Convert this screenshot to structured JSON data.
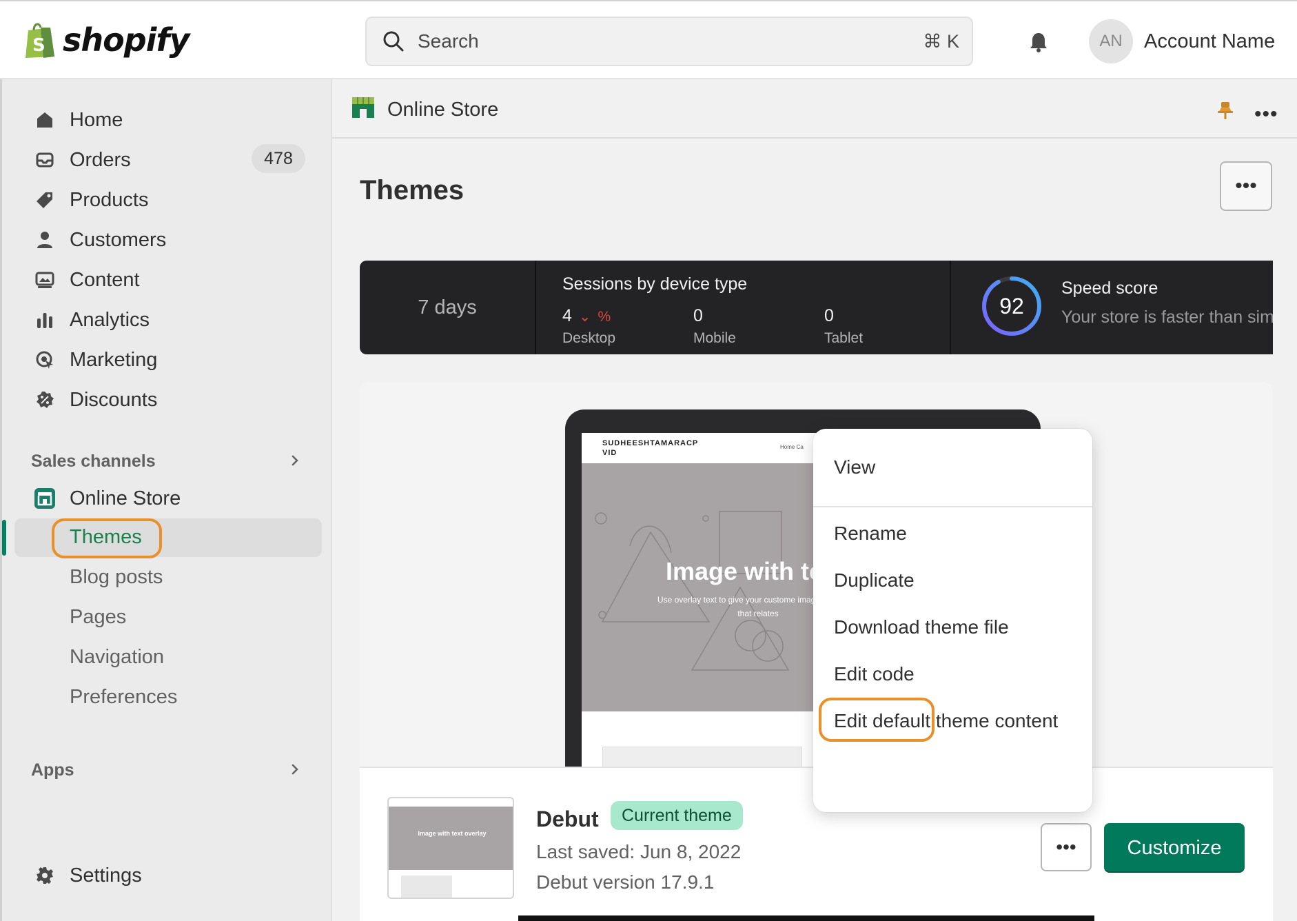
{
  "brand": {
    "name": "shopify"
  },
  "search": {
    "placeholder": "Search",
    "shortcut": "⌘ K"
  },
  "account": {
    "initials": "AN",
    "name": "Account Name"
  },
  "sidebar": {
    "items": [
      {
        "label": "Home",
        "icon": "home-icon"
      },
      {
        "label": "Orders",
        "icon": "orders-icon",
        "badge": "478"
      },
      {
        "label": "Products",
        "icon": "tag-icon"
      },
      {
        "label": "Customers",
        "icon": "person-icon"
      },
      {
        "label": "Content",
        "icon": "image-icon"
      },
      {
        "label": "Analytics",
        "icon": "bar-chart-icon"
      },
      {
        "label": "Marketing",
        "icon": "target-icon"
      },
      {
        "label": "Discounts",
        "icon": "discount-icon"
      }
    ],
    "sales_channels_label": "Sales channels",
    "online_store_label": "Online Store",
    "sub_items": [
      "Themes",
      "Blog posts",
      "Pages",
      "Navigation",
      "Preferences"
    ],
    "apps_label": "Apps",
    "settings_label": "Settings"
  },
  "header": {
    "title": "Online Store",
    "more": "•••"
  },
  "page": {
    "title": "Themes",
    "more": "•••"
  },
  "stats": {
    "period": "7 days",
    "sessions_title": "Sessions by device type",
    "desktop_value": "4",
    "desktop_change": "%",
    "desktop_label": "Desktop",
    "mobile_value": "0",
    "mobile_label": "Mobile",
    "tablet_value": "0",
    "tablet_label": "Tablet",
    "speed_score": "92",
    "speed_title": "Speed score",
    "speed_subtitle": "Your store is faster than sim"
  },
  "preview": {
    "site_name": "SUDHEESHTAMARACP VID",
    "nav": "Home   Ca",
    "hero_title": "Image with te",
    "hero_subtitle": "Use overlay text to give your custome imagery and text that relates"
  },
  "theme": {
    "thumb_text": "Image with text overlay",
    "name": "Debut",
    "badge": "Current theme",
    "last_saved": "Last saved: Jun 8, 2022",
    "version": "Debut version 17.9.1",
    "more": "•••",
    "customize_label": "Customize"
  },
  "menu": {
    "items": [
      "View",
      "Rename",
      "Duplicate",
      "Download theme file",
      "Edit code",
      "Edit default theme content"
    ]
  },
  "colors": {
    "accent": "#008060",
    "highlight": "#e8902a",
    "badge_bg": "#a8e8cd"
  }
}
